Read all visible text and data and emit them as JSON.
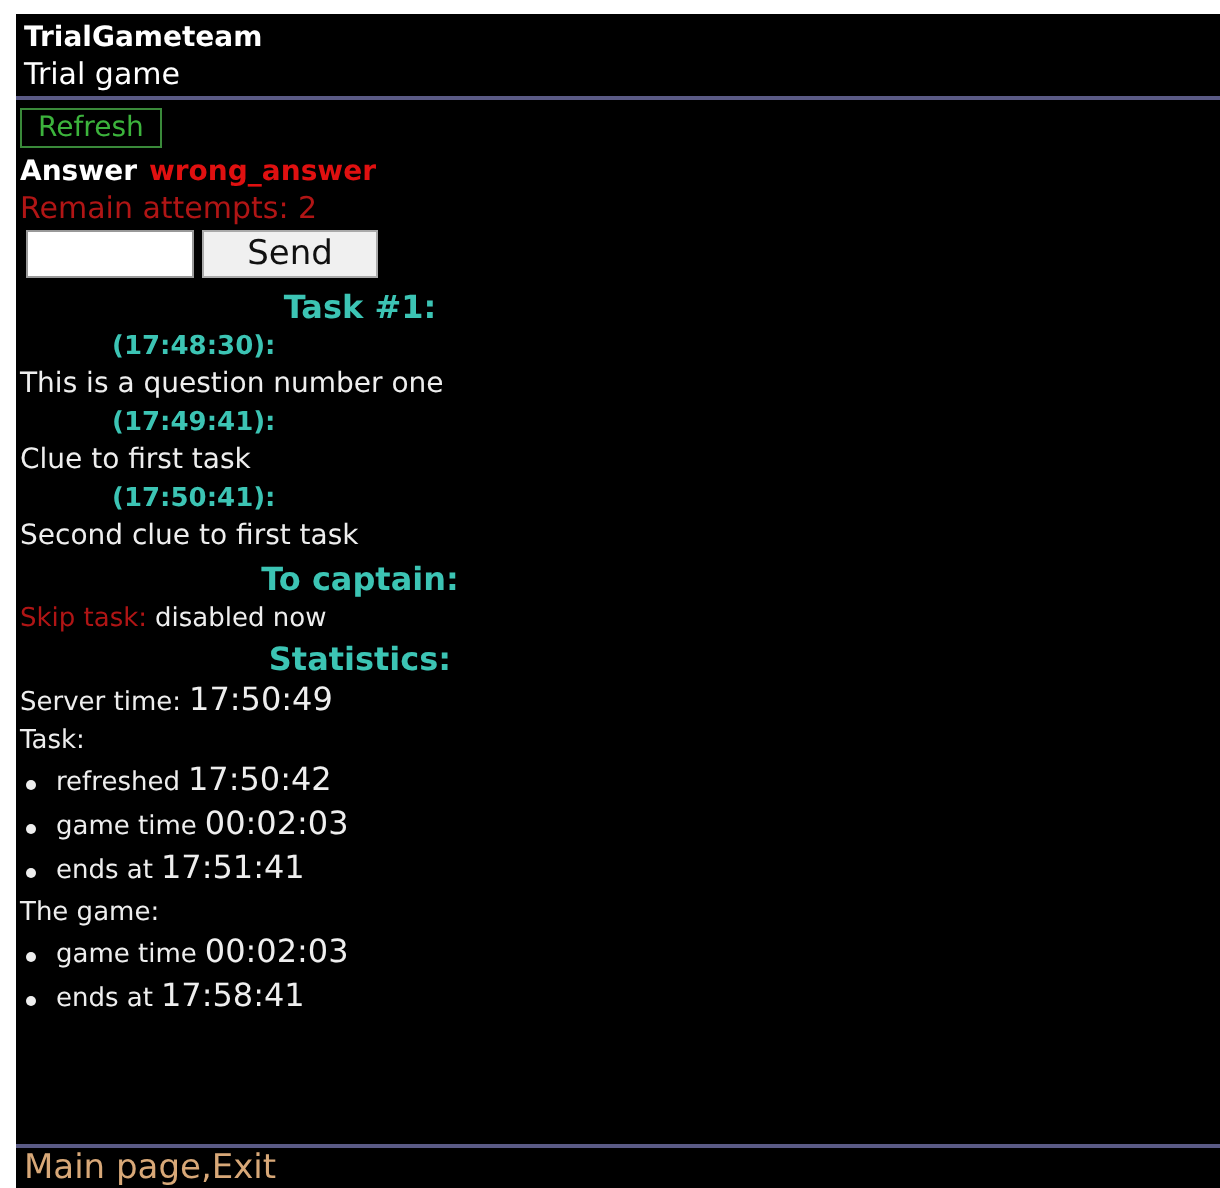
{
  "team": "TrialGameteam",
  "game": "Trial game",
  "refresh": "Refresh",
  "answer": {
    "label": "Answer",
    "value": "wrong_answer"
  },
  "attempts": "Remain attempts: 2",
  "send": "Send",
  "task": {
    "heading": "Task #1:",
    "messages": [
      {
        "time": "(17:48:30):",
        "text": "This is a question number one"
      },
      {
        "time": "(17:49:41):",
        "text": "Clue to first task"
      },
      {
        "time": "(17:50:41):",
        "text": "Second clue to first task"
      }
    ]
  },
  "captain": {
    "heading": "To captain:",
    "action": "Skip task:",
    "status": "disabled now"
  },
  "statistics": {
    "heading": "Statistics:",
    "server_label": "Server time:",
    "server_time": "17:50:49",
    "groups": [
      {
        "title": "Task:",
        "items": [
          {
            "label": "refreshed",
            "value": "17:50:42"
          },
          {
            "label": "game time",
            "value": "00:02:03"
          },
          {
            "label": "ends at",
            "value": "17:51:41"
          }
        ]
      },
      {
        "title": "The game:",
        "items": [
          {
            "label": "game time",
            "value": "00:02:03"
          },
          {
            "label": "ends at",
            "value": "17:58:41"
          }
        ]
      }
    ]
  },
  "footer": "Main page,Exit"
}
